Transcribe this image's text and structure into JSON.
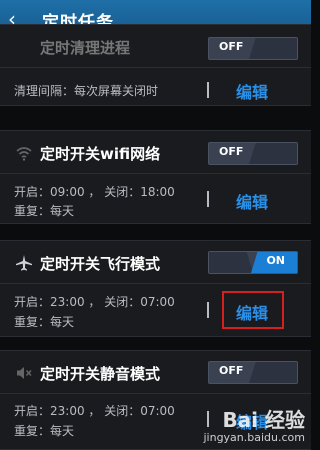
{
  "header": {
    "back_icon": "‹",
    "title": "定时任务"
  },
  "tasks": [
    {
      "title": "定时清理进程",
      "toggle": "OFF",
      "info_line1": "清理间隔：每次屏幕关闭时",
      "edit": "编辑"
    },
    {
      "title": "定时开关wifi网络",
      "toggle": "OFF",
      "info_line1": "开启：09:00 ， 关闭：18:00",
      "info_line2": "重复：每天",
      "edit": "编辑"
    },
    {
      "title": "定时开关飞行模式",
      "toggle": "ON",
      "info_line1": "开启：23:00 ， 关闭：07:00",
      "info_line2": "重复：每天",
      "edit": "编辑"
    },
    {
      "title": "定时开关静音模式",
      "toggle": "OFF",
      "info_line1": "开启：23:00 ， 关闭：07:00",
      "info_line2": "重复：每天",
      "edit": "编辑"
    }
  ],
  "watermark": {
    "logo": "Bai 经验",
    "url": "jingyan.baidu.com"
  },
  "colors": {
    "header": "#1f6fa8",
    "accent": "#2b8fe6",
    "highlight": "#d62020"
  }
}
